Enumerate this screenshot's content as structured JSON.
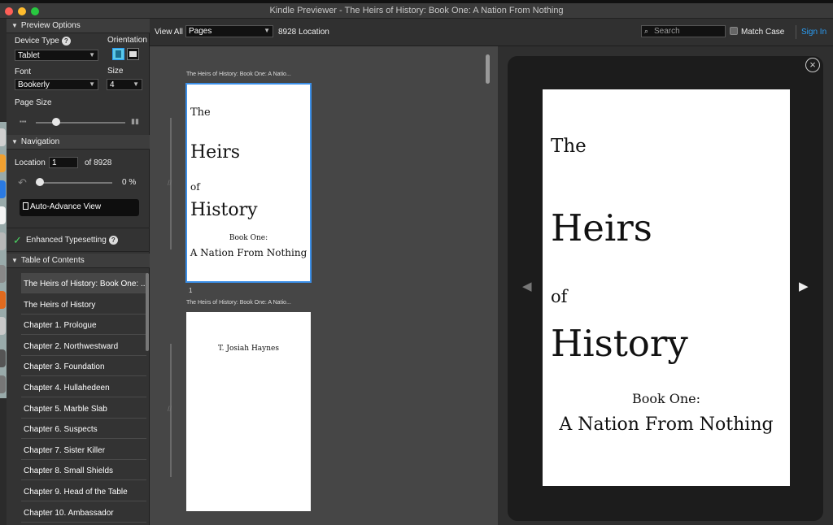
{
  "window": {
    "title": "Kindle Previewer - The Heirs of History: Book One: A Nation From Nothing"
  },
  "colors": {
    "accent": "#2a9df4",
    "selected_border": "#3b8fe8",
    "check_green": "#4cd964",
    "close": "#fe5f57",
    "minimize": "#febc2e",
    "maximize": "#28c840"
  },
  "sidebar": {
    "preview_options": {
      "header": "Preview Options",
      "device_type_label": "Device Type",
      "device_type_value": "Tablet",
      "orientation_label": "Orientation",
      "font_label": "Font",
      "font_value": "Bookerly",
      "size_label": "Size",
      "size_value": "4",
      "page_size_label": "Page Size",
      "page_size_level": 0.2
    },
    "navigation": {
      "header": "Navigation",
      "location_label": "Location",
      "location_value": "1",
      "location_total": "of 8928",
      "progress_label": "0 %",
      "progress_value": 0.0,
      "auto_advance_label": "Auto-Advance View"
    },
    "enhanced_typesetting": {
      "check": "✓",
      "label": "Enhanced Typesetting"
    },
    "toc": {
      "header": "Table of Contents",
      "items": [
        "The Heirs of History: Book One: ...",
        "The Heirs of History",
        "Chapter 1. Prologue",
        "Chapter 2. Northwestward",
        "Chapter 3. Foundation",
        "Chapter 4. Hullahedeen",
        "Chapter 5. Marble Slab",
        "Chapter 6. Suspects",
        "Chapter 7. Sister Killer",
        "Chapter 8. Small Shields",
        "Chapter 9. Head of the Table",
        "Chapter 10. Ambassador"
      ]
    }
  },
  "toolbar": {
    "view_all_label": "View All",
    "view_mode_value": "Pages",
    "location_count": "8928 Location",
    "search_placeholder": "Search",
    "match_case_label": "Match Case",
    "sign_in_label": "Sign In"
  },
  "thumbnails": {
    "pages": [
      {
        "caption": "The Heirs of History: Book One: A Natio...",
        "number": "1",
        "lines": [
          "The",
          "Heirs",
          "of",
          "History",
          "Book One:",
          "A Nation From Nothing"
        ]
      },
      {
        "caption": "The Heirs of History: Book One: A Natio...",
        "number": "",
        "lines": [
          "T. Josiah Haynes"
        ]
      }
    ]
  },
  "preview": {
    "lines": [
      "The",
      "Heirs",
      "of",
      "History",
      "Book One:",
      "A Nation From Nothing"
    ]
  }
}
